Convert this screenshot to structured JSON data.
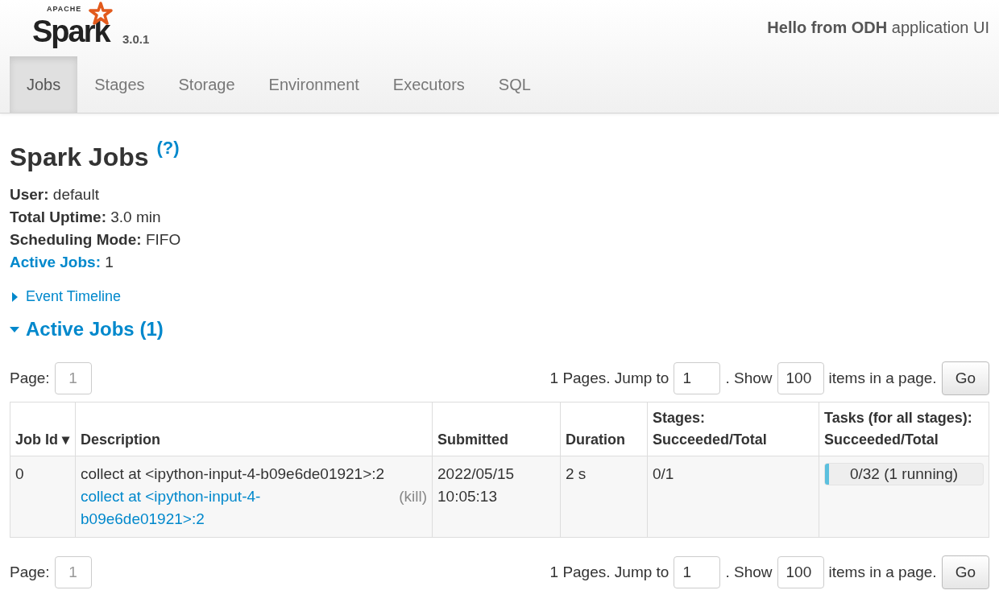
{
  "header": {
    "logo": {
      "small": "APACHE",
      "name": "Spark"
    },
    "version": "3.0.1",
    "greeting": "**Hello from ODH** application UI"
  },
  "tabs": [
    {
      "label": "Jobs",
      "selected": true
    },
    {
      "label": "Stages",
      "selected": false
    },
    {
      "label": "Storage",
      "selected": false
    },
    {
      "label": "Environment",
      "selected": false
    },
    {
      "label": "Executors",
      "selected": false
    },
    {
      "label": "SQL",
      "selected": false
    }
  ],
  "title": "Spark Jobs",
  "help": "(?)",
  "summary": [
    {
      "label": "User:",
      "value": "default",
      "kind": "plain"
    },
    {
      "label": "Total Uptime:",
      "value": "3.0 min",
      "kind": "plain"
    },
    {
      "label": "Scheduling Mode:",
      "value": "FIFO",
      "kind": "plain"
    },
    {
      "label": "Active Jobs:",
      "value": "1",
      "kind": "link"
    }
  ],
  "event_timeline": {
    "label": "Event Timeline",
    "expanded": false
  },
  "active_jobs": {
    "label": "Active Jobs (1)",
    "expanded": true
  },
  "pagers": [
    {
      "page_label": "Page:",
      "page": "1",
      "pages_text": "1 Pages. Jump to",
      "jump": "1",
      "show_label": ". Show",
      "show": "100",
      "items_label": "items in a page.",
      "button": "Go"
    },
    {
      "page_label": "Page:",
      "page": "1",
      "pages_text": "1 Pages. Jump to",
      "jump": "1",
      "show_label": ". Show",
      "show": "100",
      "items_label": "items in a page.",
      "button": "Go"
    }
  ],
  "table": {
    "columns": [
      "Job Id ▾",
      "Description",
      "Submitted",
      "Duration",
      "Stages: Succeeded/Total",
      "Tasks (for all stages): Succeeded/Total"
    ],
    "rows": [
      {
        "job_id": "0",
        "description": "collect at <ipython-input-4-b09e6de01921>:2",
        "link": "collect at <ipython-input-4-b09e6de01921>:2",
        "kill": "(kill)",
        "submitted": "2022/05/15 10:05:13",
        "duration": "2 s",
        "stages": "0/1",
        "tasks": "0/32 (1 running)",
        "level": 0.01
      }
    ]
  }
}
